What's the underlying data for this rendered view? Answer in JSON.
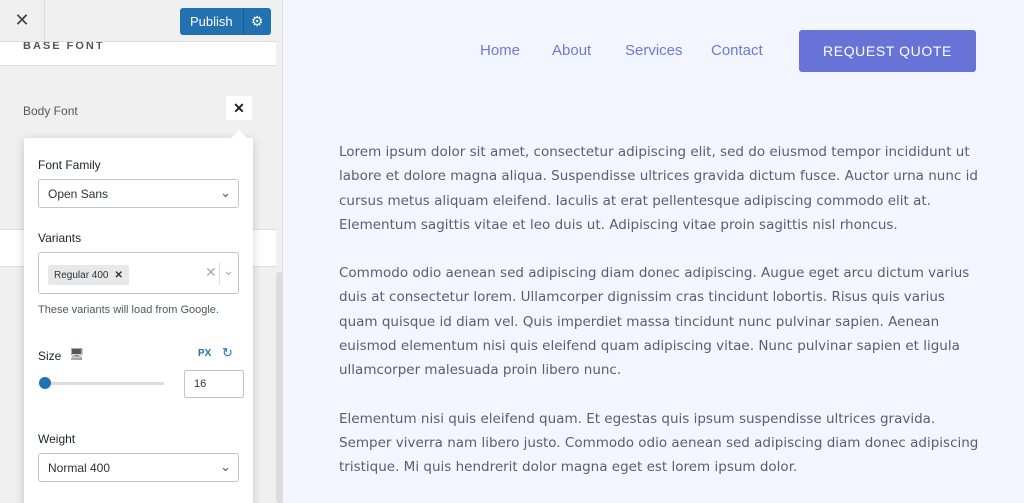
{
  "panel": {
    "close_icon": "close-icon",
    "publish_label": "Publish",
    "publish_settings_icon": "gear-icon",
    "section_heading": "BASE FONT",
    "body_font_label": "Body Font",
    "body_font_close_icon": "close-icon"
  },
  "popup": {
    "font_family": {
      "label": "Font Family",
      "value": "Open Sans"
    },
    "variants": {
      "label": "Variants",
      "selected": [
        "Regular 400"
      ],
      "hint": "These variants will load from Google."
    },
    "size": {
      "label": "Size",
      "device_icon": "desktop-icon",
      "unit": "PX",
      "reset_icon": "reset-icon",
      "value": "16",
      "slider_level": 0.03
    },
    "weight": {
      "label": "Weight",
      "value": "Normal 400"
    }
  },
  "site": {
    "nav": [
      "Home",
      "About",
      "Services",
      "Contact"
    ],
    "cta": "REQUEST QUOTE",
    "paragraphs": [
      "Lorem ipsum dolor sit amet, consectetur adipiscing elit, sed do eiusmod tempor incididunt ut labore et dolore magna aliqua. Suspendisse ultrices gravida dictum fusce. Auctor urna nunc id cursus metus aliquam eleifend. Iaculis at erat pellentesque adipiscing commodo elit at. Elementum sagittis vitae et leo duis ut. Adipiscing vitae proin sagittis nisl rhoncus.",
      "Commodo odio aenean sed adipiscing diam donec adipiscing. Augue eget arcu dictum varius duis at consectetur lorem. Ullamcorper dignissim cras tincidunt lobortis. Risus quis varius quam quisque id diam vel. Quis imperdiet massa tincidunt nunc pulvinar sapien. Aenean euismod elementum nisi quis eleifend quam adipiscing vitae. Nunc pulvinar sapien et ligula ullamcorper malesuada proin libero nunc.",
      "Elementum nisi quis eleifend quam. Et egestas quis ipsum suspendisse ultrices gravida. Semper viverra nam libero justo. Commodo odio aenean sed adipiscing diam donec adipiscing tristique. Mi quis hendrerit dolor magna eget est lorem ipsum dolor."
    ],
    "colors": {
      "accent": "#6873d7",
      "link": "#6d78d8",
      "background": "#f4f6ff"
    }
  }
}
